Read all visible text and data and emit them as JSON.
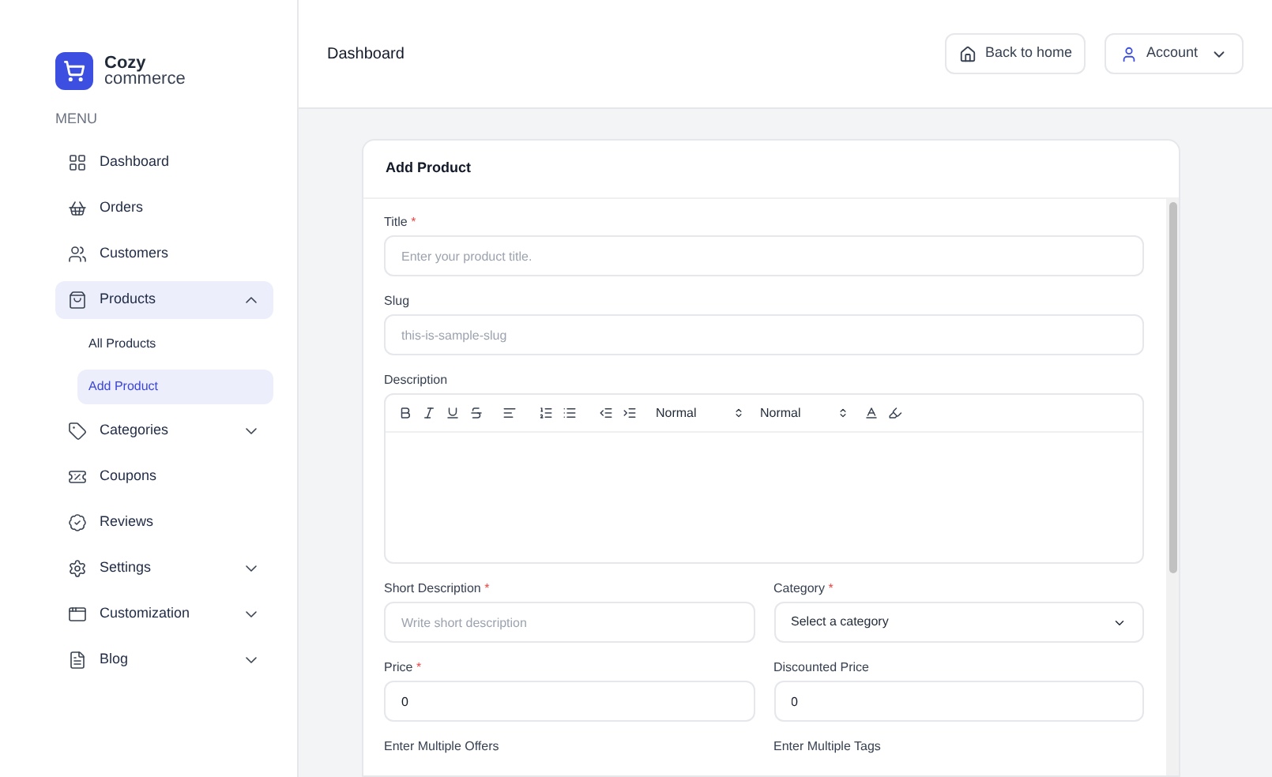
{
  "brand": {
    "line1": "Cozy",
    "line2": "commerce"
  },
  "sidebar": {
    "heading": "MENU",
    "items": [
      {
        "label": "Dashboard",
        "has_children": false,
        "selected": false
      },
      {
        "label": "Orders",
        "has_children": false,
        "selected": false
      },
      {
        "label": "Customers",
        "has_children": false,
        "selected": false
      },
      {
        "label": "Products",
        "expanded": true,
        "has_children": true,
        "selected": true,
        "children": [
          {
            "label": "All Products",
            "selected": false
          },
          {
            "label": "Add Product",
            "selected": true
          }
        ]
      },
      {
        "label": "Categories",
        "expanded": false,
        "has_children": true,
        "selected": false
      },
      {
        "label": "Coupons",
        "has_children": false,
        "selected": false
      },
      {
        "label": "Reviews",
        "has_children": false,
        "selected": false
      },
      {
        "label": "Settings",
        "expanded": false,
        "has_children": true,
        "selected": false
      },
      {
        "label": "Customization",
        "expanded": false,
        "has_children": true,
        "selected": false
      },
      {
        "label": "Blog",
        "expanded": false,
        "has_children": true,
        "selected": false
      }
    ]
  },
  "header": {
    "title": "Dashboard",
    "back_button": "Back to home",
    "account_button": "Account"
  },
  "card": {
    "title": "Add Product",
    "rows": [
      [
        {
          "kind": "text",
          "label": "Title",
          "required_mark": "*",
          "placeholder": "Enter your product title."
        }
      ],
      [
        {
          "kind": "text",
          "label": "Slug",
          "placeholder": "this-is-sample-slug"
        }
      ],
      [
        {
          "kind": "editor",
          "label": "Description",
          "selects": [
            "Normal",
            "Normal"
          ]
        }
      ],
      [
        {
          "kind": "text",
          "label": "Short Description",
          "required_mark": "*",
          "placeholder": "Write short description"
        },
        {
          "kind": "select",
          "label": "Category",
          "required_mark": "*",
          "value": "Select a category"
        }
      ],
      [
        {
          "kind": "text",
          "label": "Price",
          "required_mark": "*",
          "value": "0"
        },
        {
          "kind": "text",
          "label": "Discounted Price",
          "value": "0"
        }
      ],
      [
        {
          "kind": "label",
          "label": "Enter Multiple Offers"
        },
        {
          "kind": "label",
          "label": "Enter Multiple Tags"
        }
      ]
    ]
  }
}
